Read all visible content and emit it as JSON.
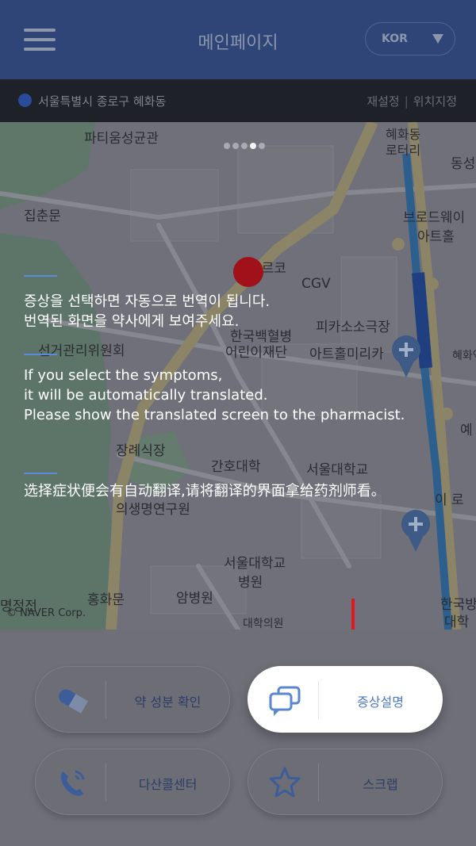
{
  "header": {
    "title": "메인페이지",
    "language": "KOR"
  },
  "location": {
    "address": "서울특별시 종로구 혜화동",
    "reset_label": "재설정",
    "set_label": "위치지정"
  },
  "map": {
    "copyright": "© NAVER Corp.",
    "labels": [
      "파티움성균관",
      "혜화동",
      "로터리",
      "동성",
      "집춘문",
      "브로드웨이",
      "아트홀",
      "아르코",
      "CGV",
      "피카소소극장",
      "선거관리위원회",
      "한국백혈병",
      "어린이재단",
      "아트홀미리카",
      "혜화역",
      "장례식장",
      "간호대학",
      "서울대학교",
      "의생명연구원",
      "서울대학교",
      "병원",
      "홍화문",
      "암병원",
      "대학의원",
      "한국방",
      "대학",
      "예",
      "이 로",
      "명정전"
    ]
  },
  "pager": {
    "count": 5,
    "active": 3
  },
  "instructions": {
    "korean": [
      "증상을 선택하면 자동으로 번역이 됩니다.",
      "번역된 화면을 약사에게 보여주세요."
    ],
    "english": [
      "If you select the symptoms,",
      "it will be automatically translated.",
      "Please show the translated screen to the pharmacist."
    ],
    "chinese": [
      "选择症状便会有自动翻译,请将翻译的界面拿给药剂师看。"
    ]
  },
  "buttons": {
    "ingredient": {
      "label": "약 성분 확인",
      "icon": "pill-icon"
    },
    "symptom": {
      "label": "증상설명",
      "icon": "chat-bubbles-icon"
    },
    "callcenter": {
      "label": "다산콜센터",
      "icon": "phone-icon"
    },
    "scrap": {
      "label": "스크랩",
      "icon": "star-icon"
    }
  },
  "colors": {
    "header_bg": "#2f4577",
    "accent": "#4c79c8",
    "marker": "#a0111a",
    "arrow": "#e3161d"
  }
}
